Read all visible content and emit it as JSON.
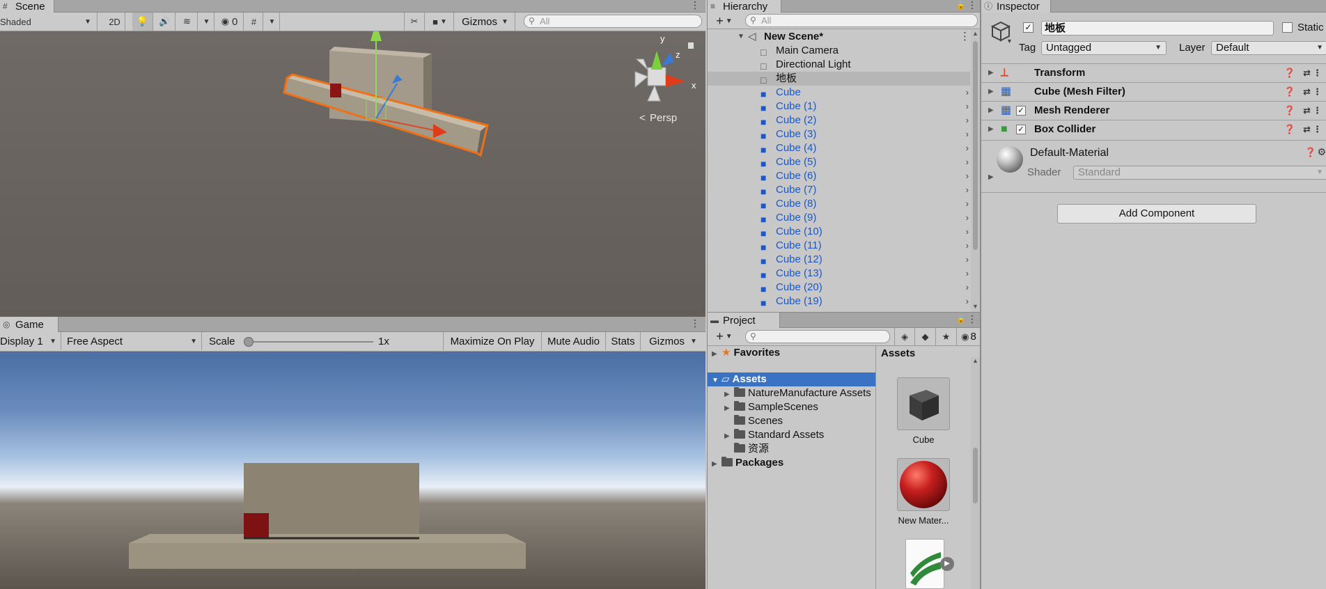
{
  "scene": {
    "tab_label": "Scene",
    "shading_mode": "Shaded",
    "btn_2d": "2D",
    "hidden_count": "0",
    "gizmos_label": "Gizmos",
    "search_placeholder": "All",
    "gizmo_axes": {
      "y": "y",
      "z": "z",
      "x": "x"
    },
    "projection_label": "Persp"
  },
  "game": {
    "tab_label": "Game",
    "display": "Display 1",
    "aspect": "Free Aspect",
    "scale_label": "Scale",
    "scale_value": "1x",
    "scale_fraction": 0.0,
    "maximize_label": "Maximize On Play",
    "mute_label": "Mute Audio",
    "stats_label": "Stats",
    "gizmos_label": "Gizmos"
  },
  "hierarchy": {
    "tab_label": "Hierarchy",
    "search_placeholder": "All",
    "scene_name": "New Scene*",
    "items": [
      {
        "label": "Main Camera",
        "prefab": false
      },
      {
        "label": "Directional Light",
        "prefab": false
      },
      {
        "label": "地板",
        "prefab": false,
        "selected": true
      },
      {
        "label": "Cube",
        "prefab": true
      },
      {
        "label": "Cube (1)",
        "prefab": true
      },
      {
        "label": "Cube (2)",
        "prefab": true
      },
      {
        "label": "Cube (3)",
        "prefab": true
      },
      {
        "label": "Cube (4)",
        "prefab": true
      },
      {
        "label": "Cube (5)",
        "prefab": true
      },
      {
        "label": "Cube (6)",
        "prefab": true
      },
      {
        "label": "Cube (7)",
        "prefab": true
      },
      {
        "label": "Cube (8)",
        "prefab": true
      },
      {
        "label": "Cube (9)",
        "prefab": true
      },
      {
        "label": "Cube (10)",
        "prefab": true
      },
      {
        "label": "Cube (11)",
        "prefab": true
      },
      {
        "label": "Cube (12)",
        "prefab": true
      },
      {
        "label": "Cube (13)",
        "prefab": true
      },
      {
        "label": "Cube (20)",
        "prefab": true
      },
      {
        "label": "Cube (19)",
        "prefab": true
      }
    ]
  },
  "project": {
    "tab_label": "Project",
    "hidden_count": "8",
    "favorites": "Favorites",
    "assets_root": "Assets",
    "folders": [
      "NatureManufacture Assets",
      "SampleScenes",
      "Scenes",
      "Standard Assets",
      "资源"
    ],
    "packages": "Packages",
    "assets_header": "Assets",
    "asset_items": [
      {
        "label": "Cube",
        "icon": "cube-mesh-thumbnail"
      },
      {
        "label": "New Mater...",
        "icon": "material-sphere-thumbnail"
      },
      {
        "label": "",
        "icon": "terrain-asset-thumbnail"
      }
    ]
  },
  "inspector": {
    "tab_label": "Inspector",
    "object_name": "地板",
    "static_label": "Static",
    "tag_label": "Tag",
    "tag_value": "Untagged",
    "layer_label": "Layer",
    "layer_value": "Default",
    "components": [
      {
        "label": "Transform",
        "icon": "transform-icon",
        "has_checkbox": false
      },
      {
        "label": "Cube (Mesh Filter)",
        "icon": "mesh-filter-icon",
        "has_checkbox": false
      },
      {
        "label": "Mesh Renderer",
        "icon": "mesh-renderer-icon",
        "has_checkbox": true
      },
      {
        "label": "Box Collider",
        "icon": "box-collider-icon",
        "has_checkbox": true
      }
    ],
    "material_name": "Default-Material",
    "shader_label": "Shader",
    "shader_value": "Standard",
    "add_component": "Add Component"
  },
  "colors": {
    "selection_orange": "#f07016",
    "prefab_blue": "#1a57c8",
    "project_selection": "#3a72c4"
  }
}
